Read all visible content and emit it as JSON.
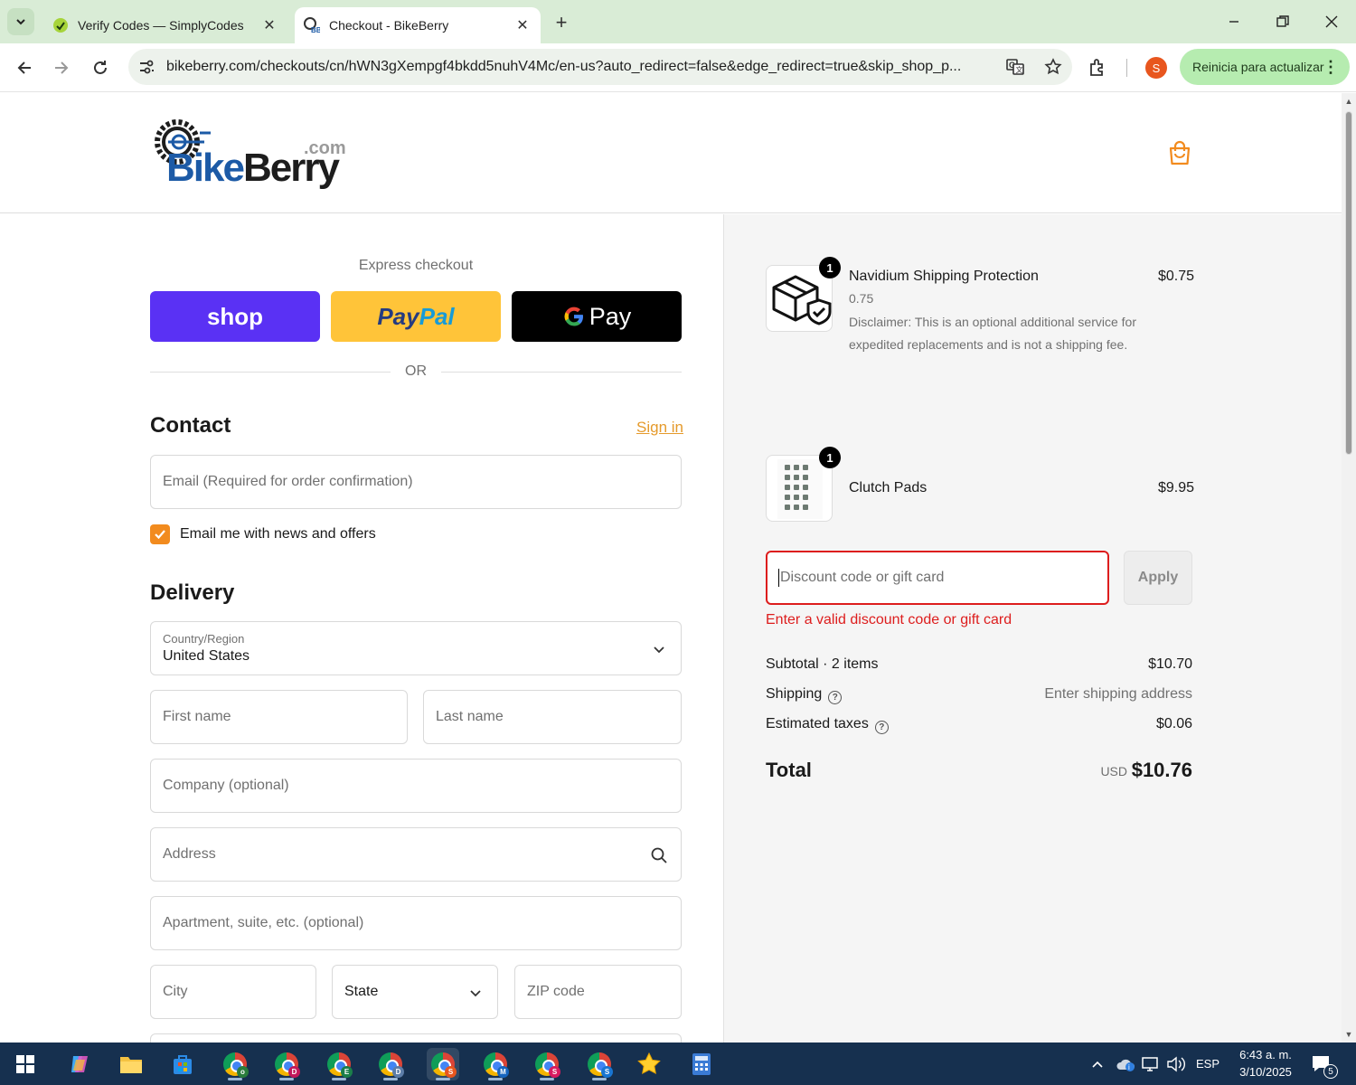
{
  "browser": {
    "tabs": [
      {
        "title": "Verify Codes — SimplyCodes",
        "active": false
      },
      {
        "title": "Checkout - BikeBerry",
        "active": true
      }
    ],
    "url": "bikeberry.com/checkouts/cn/hWN3gXempgf4bkdd5nuhV4Mc/en-us?auto_redirect=false&edge_redirect=true&skip_shop_p...",
    "profile_initial": "S",
    "update_label": "Reinicia para actualizar"
  },
  "header": {
    "logo_main": "Bike",
    "logo_accent": "Berry",
    "logo_suffix": ".com"
  },
  "express": {
    "title": "Express checkout",
    "shop_label": "shop",
    "paypal_a": "Pay",
    "paypal_b": "Pal",
    "gpay_label": "Pay",
    "or_label": "OR"
  },
  "contact": {
    "heading": "Contact",
    "signin_label": "Sign in",
    "email_placeholder": "Email (Required for order confirmation)",
    "newsletter_label": "Email me with news and offers",
    "newsletter_checked": true
  },
  "delivery": {
    "heading": "Delivery",
    "country_label": "Country/Region",
    "country_value": "United States",
    "first_name": "First name",
    "last_name": "Last name",
    "company": "Company (optional)",
    "address": "Address",
    "apartment": "Apartment, suite, etc. (optional)",
    "city": "City",
    "state": "State",
    "zip": "ZIP code"
  },
  "summary": {
    "items": [
      {
        "name": "Navidium Shipping Protection",
        "price": "$0.75",
        "quantity": "1",
        "variant": "0.75",
        "disclaimer": "Disclaimer: This is an optional additional service for expedited replacements and is not a shipping fee."
      },
      {
        "name": "Clutch Pads",
        "price": "$9.95",
        "quantity": "1"
      }
    ],
    "discount_placeholder": "Discount code or gift card",
    "apply_label": "Apply",
    "discount_error": "Enter a valid discount code or gift card",
    "subtotal_label": "Subtotal · 2 items",
    "subtotal_value": "$10.70",
    "shipping_label": "Shipping",
    "shipping_value": "Enter shipping address",
    "taxes_label": "Estimated taxes",
    "taxes_value": "$0.06",
    "total_label": "Total",
    "total_currency": "USD",
    "total_value": "$10.76"
  },
  "taskbar": {
    "language": "ESP",
    "time": "6:43 a. m.",
    "date": "3/10/2025",
    "notifications": "5",
    "chrome_badges": [
      "o",
      "D",
      "E",
      "D",
      "S",
      "M",
      "S",
      "S"
    ]
  },
  "colors": {
    "accent": "#f28b1e",
    "error": "#dd1d1d",
    "shop_purple": "#5a31f4",
    "paypal_yellow": "#ffc439",
    "tab_bar": "#d9ecd6"
  }
}
